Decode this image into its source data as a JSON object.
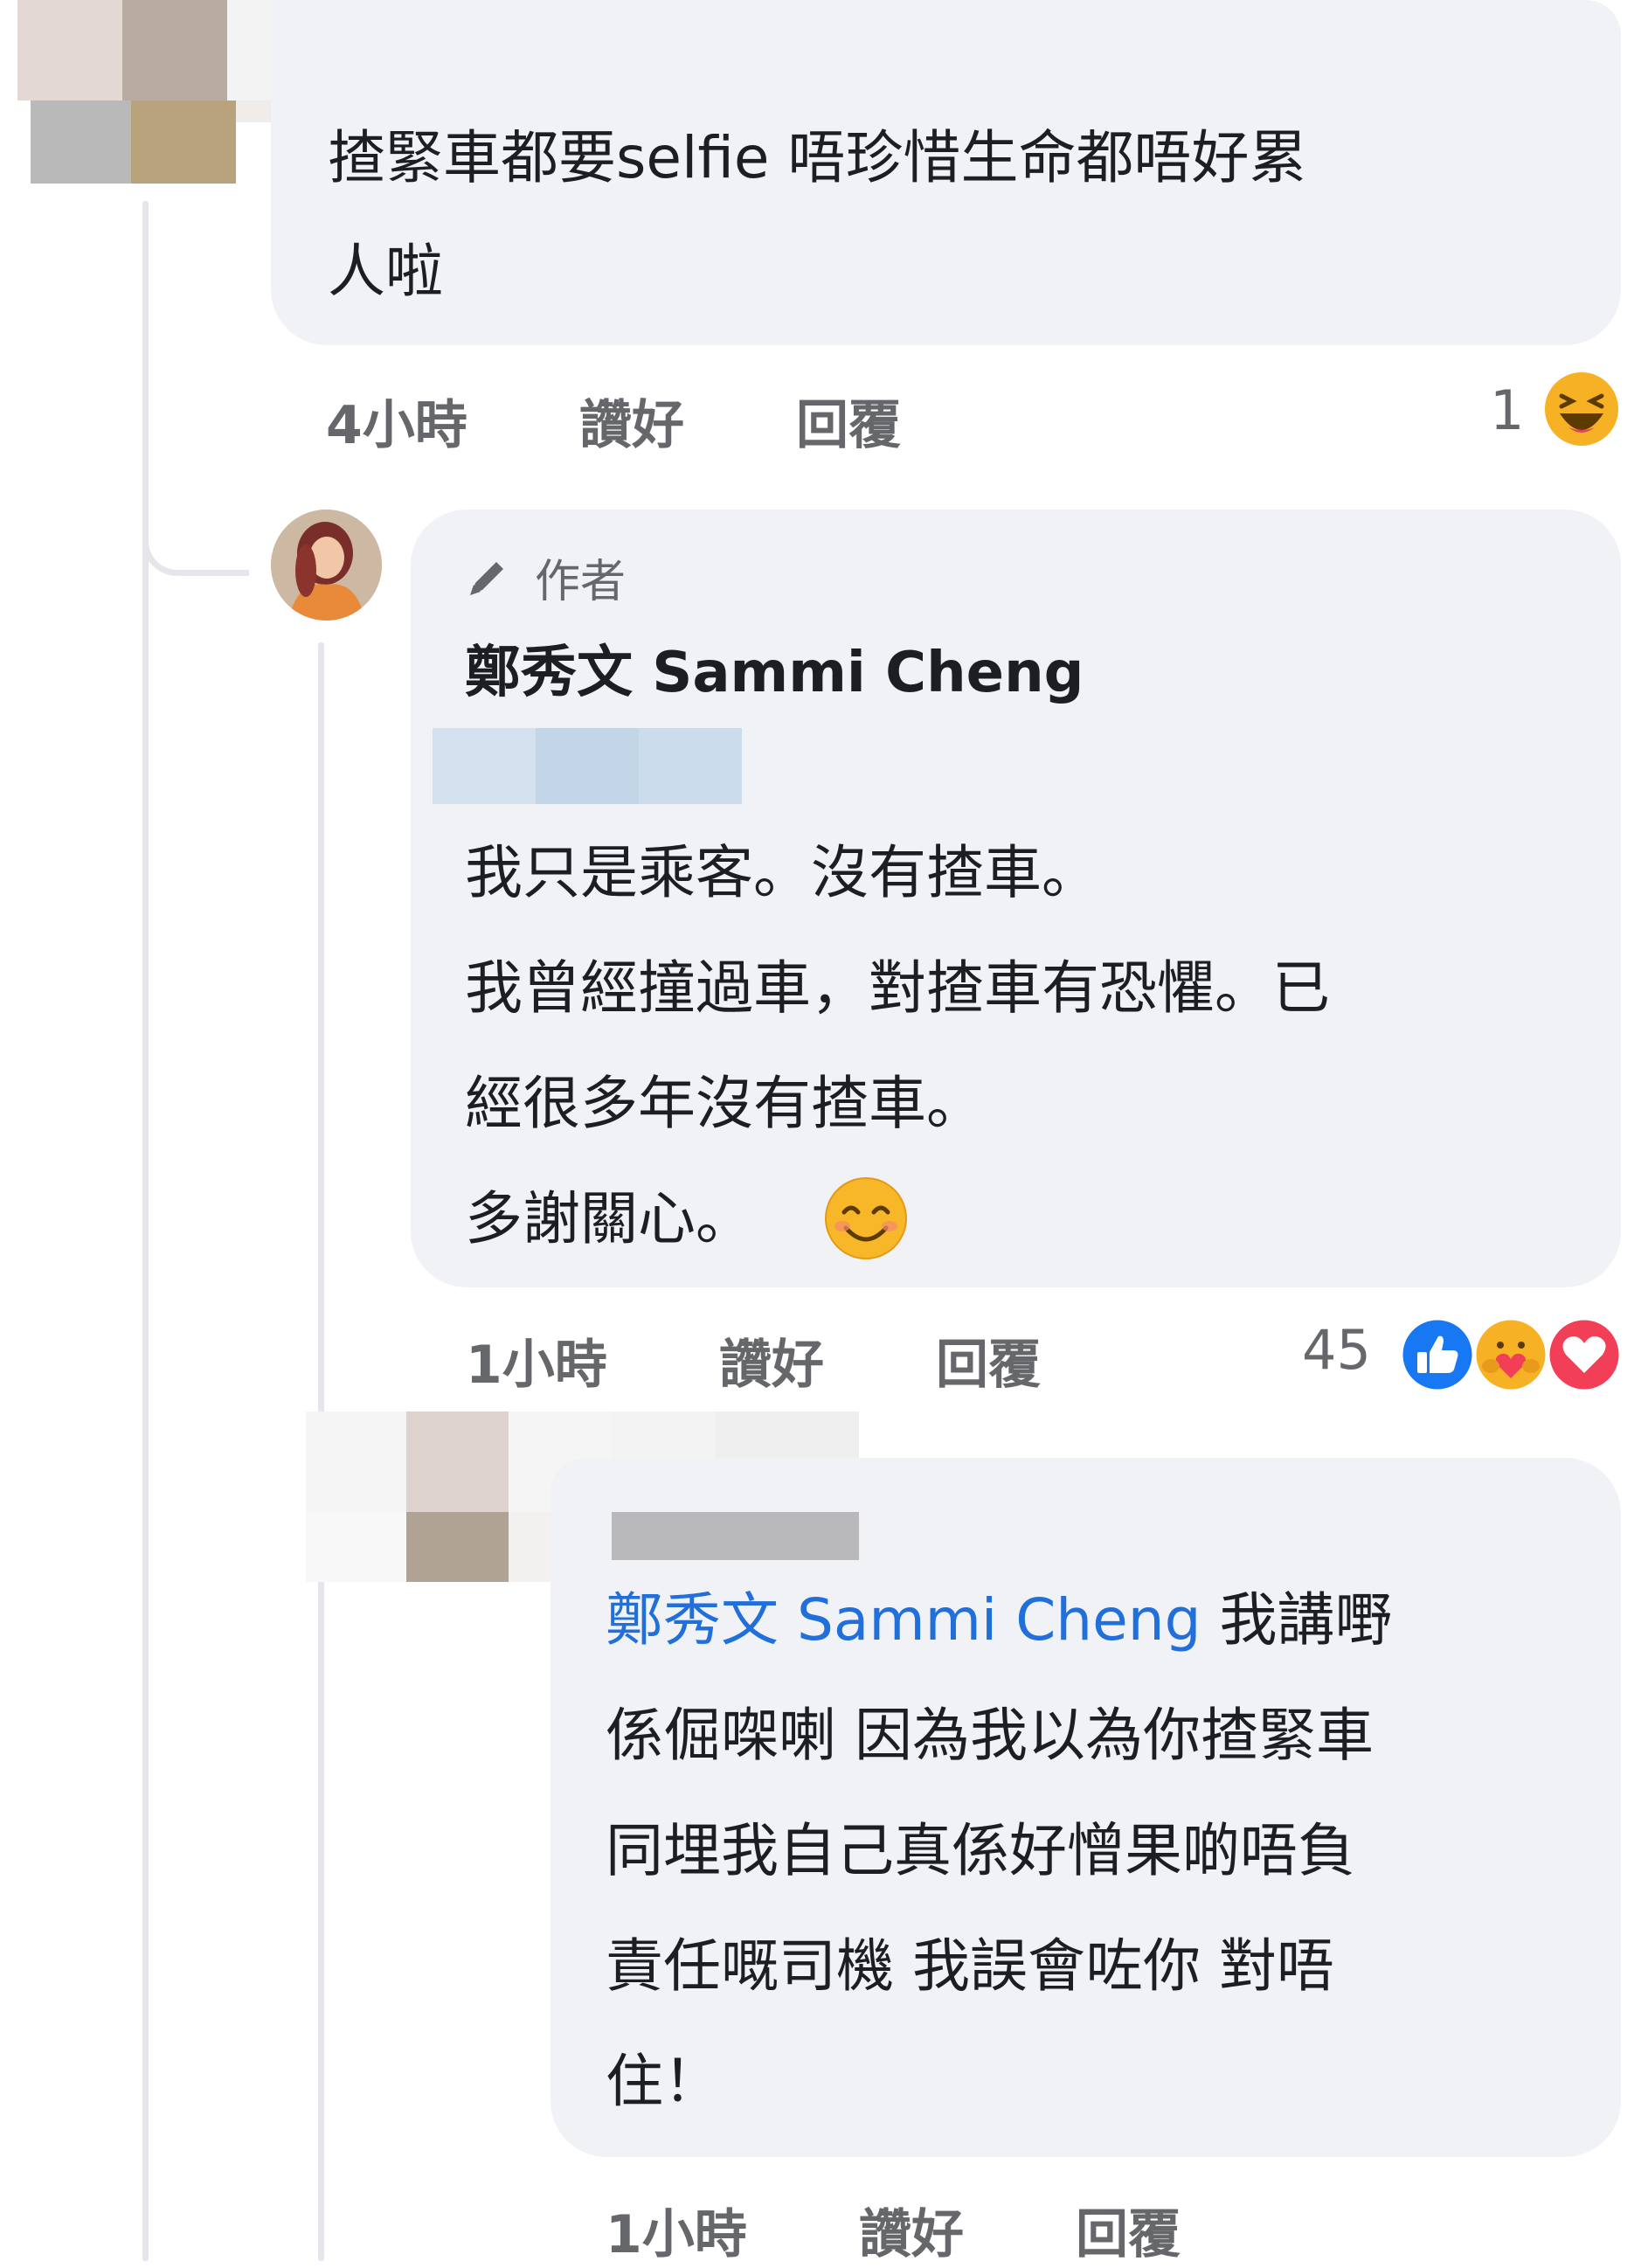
{
  "comment1": {
    "text_lines": [
      "揸緊車都要selfie 唔珍惜生命都唔好累",
      "人啦"
    ],
    "time": "4小時",
    "like_label": "讚好",
    "reply_label": "回覆",
    "reaction_count": "1"
  },
  "reply1": {
    "author_badge": "作者",
    "author_name": "鄭秀文 Sammi Cheng",
    "text_lines": [
      "我只是乘客。沒有揸車。",
      "我曾經撞過車，對揸車有恐懼。已",
      "經很多年沒有揸車。",
      "多謝關心。"
    ],
    "time": "1小時",
    "like_label": "讚好",
    "reply_label": "回覆",
    "reaction_count": "45"
  },
  "reply2": {
    "mention": "鄭秀文 Sammi Cheng",
    "first_line_rest": " 我講嘢",
    "text_lines": [
      "係倔㗎喇 因為我以為你揸緊車",
      "同埋我自己真係好憎果啲唔負",
      "責任嘅司機 我誤會咗你 對唔",
      "住！"
    ],
    "time": "1小時",
    "like_label": "讚好",
    "reply_label": "回覆"
  },
  "colors": {
    "bubble": "#f0f2f5",
    "mention": "#216fdb",
    "secondary_text": "#65676b",
    "like_blue": "#1877f2",
    "love_red": "#f33e58",
    "haha_yellow": "#f7b125"
  },
  "icons": [
    "pencil-icon",
    "haha-reaction-icon",
    "like-reaction-icon",
    "care-reaction-icon",
    "love-reaction-icon",
    "smiling-emoji-icon"
  ]
}
